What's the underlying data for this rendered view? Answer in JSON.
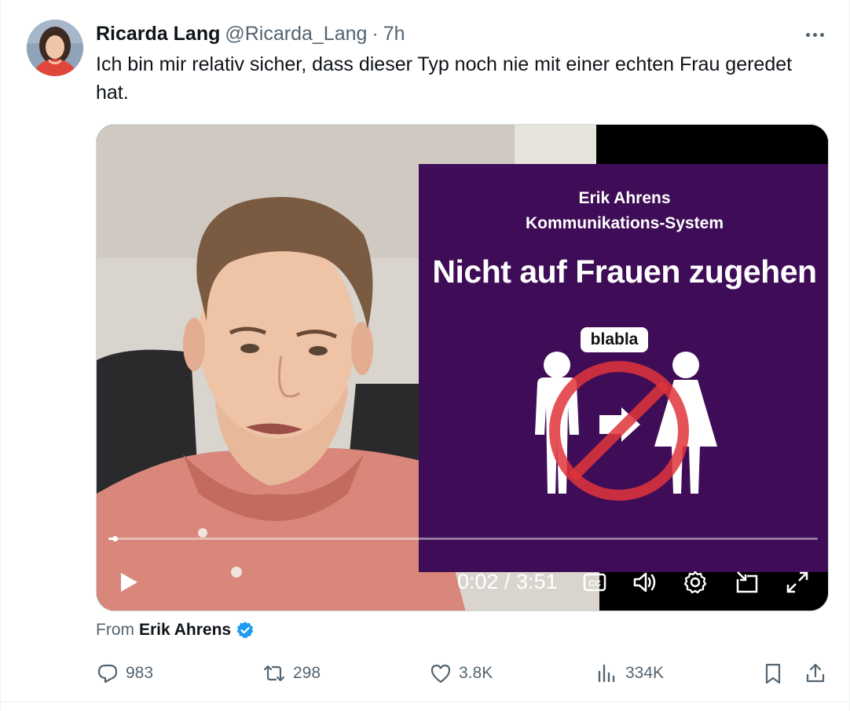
{
  "author": {
    "display_name": "Ricarda Lang",
    "handle": "@Ricarda_Lang",
    "separator": "·",
    "time": "7h"
  },
  "tweet": {
    "text": "Ich bin mir relativ sicher, dass dieser Typ noch nie mit einer echten Frau geredet hat."
  },
  "video": {
    "overlay_name": "Erik Ahrens",
    "overlay_system": "Kommunikations-System",
    "overlay_title": "Nicht auf Frauen zugehen",
    "bubble_text": "blabla",
    "current_time": "0:02",
    "total_time": "3:51",
    "time_display": "0:02 / 3:51",
    "progress_fraction": 0.009
  },
  "attribution": {
    "prefix": "From",
    "name": "Erik Ahrens",
    "verified": true
  },
  "actions": {
    "replies": "983",
    "reposts": "298",
    "likes": "3.8K",
    "views": "334K"
  },
  "icons": {
    "more": "more-horizontal-icon",
    "reply": "reply-icon",
    "repost": "repost-icon",
    "like": "heart-icon",
    "views": "views-icon",
    "bookmark": "bookmark-icon",
    "share": "share-icon",
    "verified": "verified-badge-icon"
  },
  "colors": {
    "accent_blue": "#1d9bf0",
    "secondary_text": "#536471",
    "overlay_purple": "#3f0d57",
    "prohibition_red": "#e0353b"
  }
}
